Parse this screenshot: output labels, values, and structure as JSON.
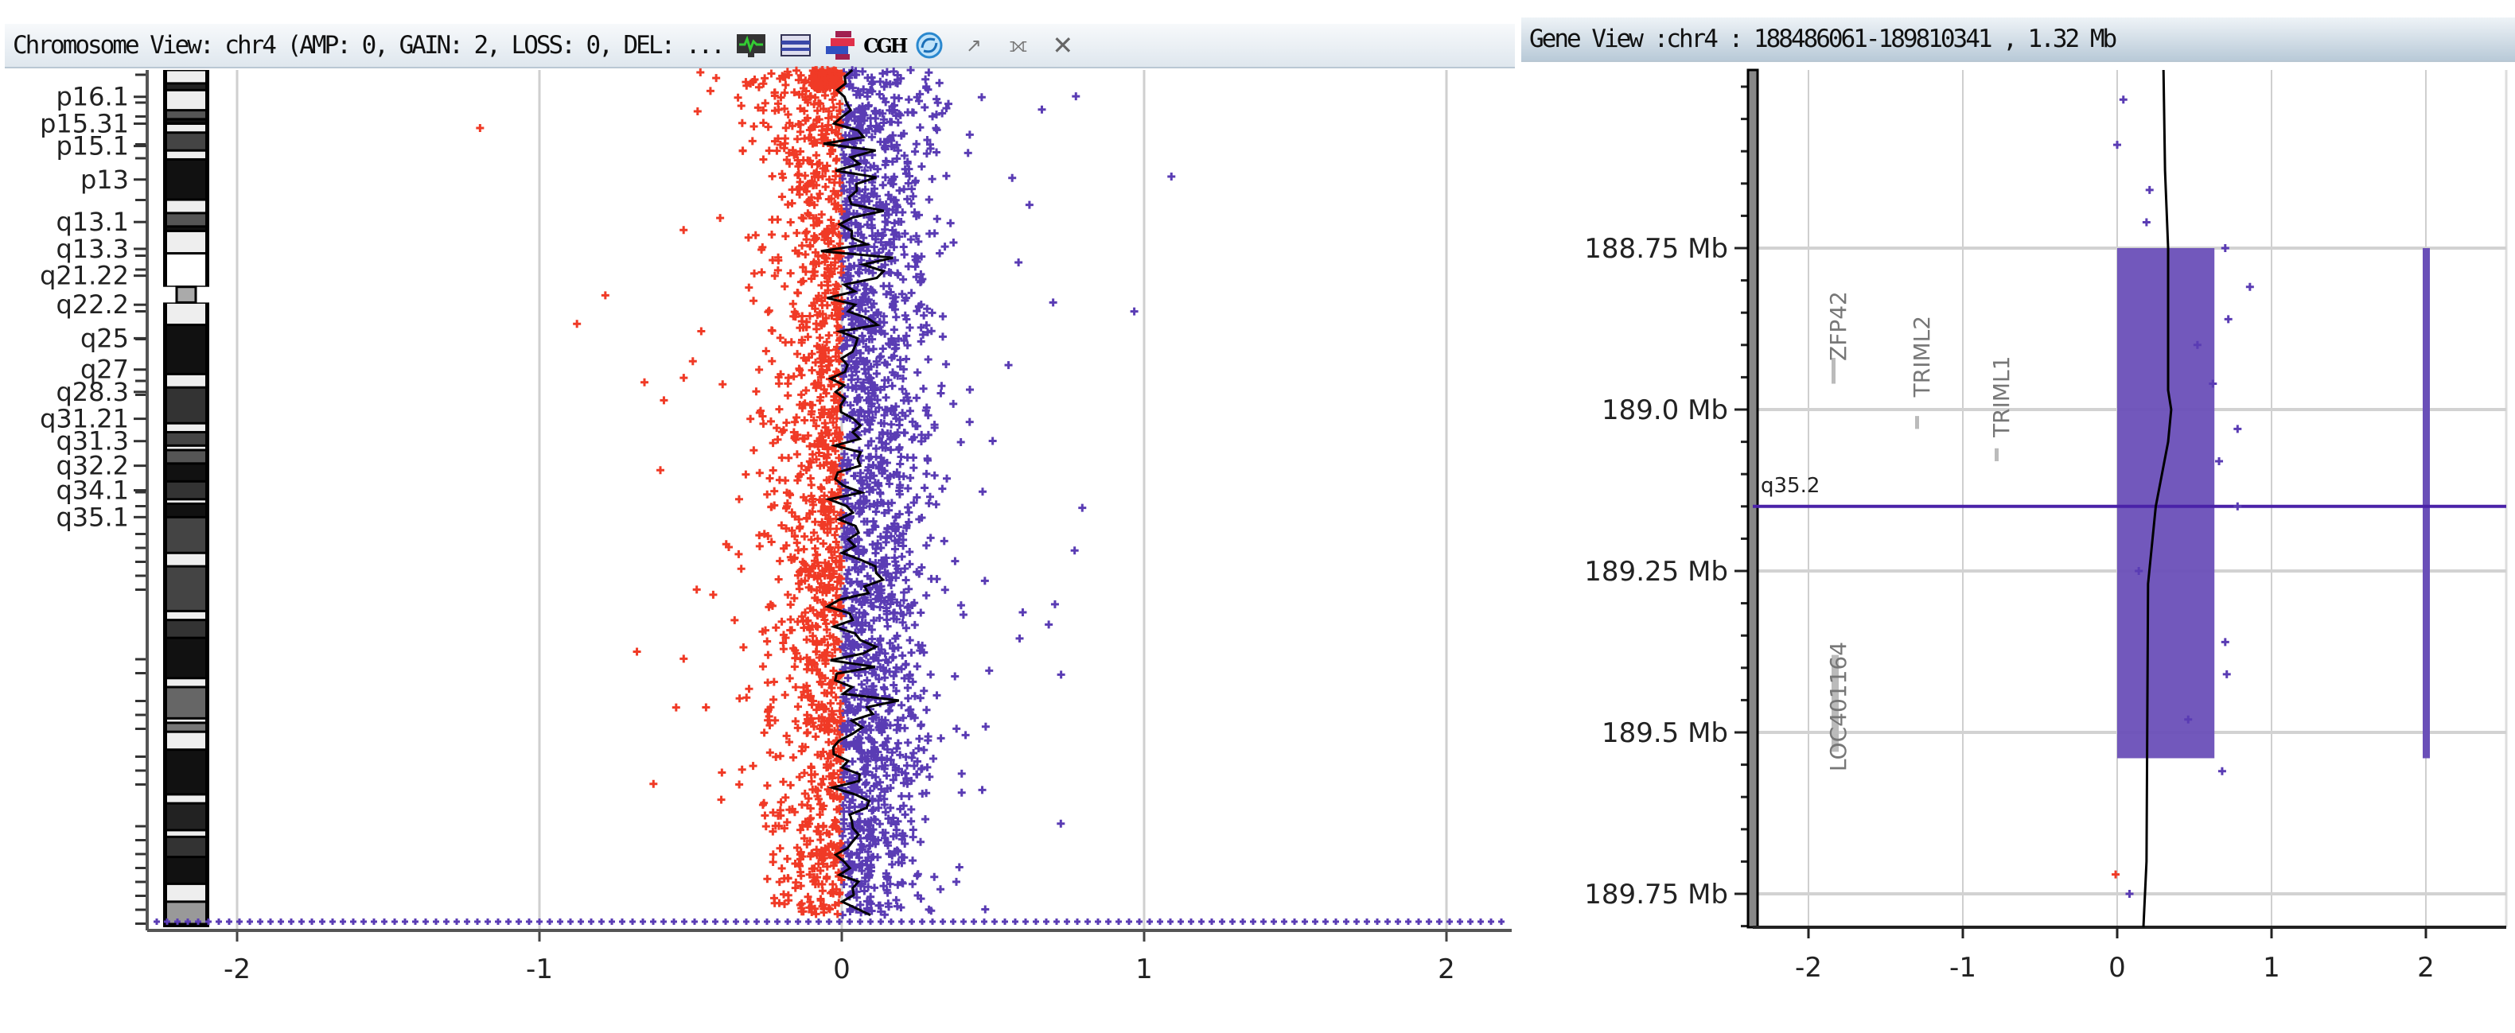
{
  "chromosome_view": {
    "title": "Chromosome View: chr4 (AMP: 0, GAIN: 2, LOSS: 0, DEL: ...",
    "icons": [
      "chart-monitor-icon",
      "lines-icon",
      "bars-icon",
      "cgh-icon",
      "refresh-icon",
      "restore-icon",
      "pin-icon",
      "close-icon"
    ],
    "cgh_label": "CGH"
  },
  "gene_view": {
    "title": "Gene View :chr4 : 188486061-189810341 , 1.32 Mb"
  },
  "colors": {
    "loss": "#f03a26",
    "gain": "#5a3cb4",
    "segment": "#6a4fb8",
    "line": "#000000"
  },
  "chart_data": [
    {
      "type": "scatter",
      "title": "Chromosome View: chr4",
      "xlabel": "",
      "ylabel": "",
      "xlim": [
        -2.3,
        2.2
      ],
      "xticks": [
        "-2",
        "-1",
        "0",
        "1",
        "2"
      ],
      "xtick_values": [
        -2,
        -1,
        0,
        1,
        2
      ],
      "y_unit": "Mb",
      "ylim": [
        0,
        191
      ],
      "band_labels": [
        "p16.1",
        "p15.31",
        "p15.1",
        "p13",
        "q13.1",
        "q13.3",
        "q21.22",
        "q22.2",
        "q25",
        "q27",
        "q28.3",
        "q31.21",
        "q31.3",
        "q32.2",
        "q34.1",
        "q35.1"
      ],
      "band_positions_mb": [
        6,
        12,
        17,
        24.5,
        34,
        40,
        46,
        52.5,
        60,
        67,
        72,
        78,
        83,
        88.5,
        94,
        100
      ],
      "grid": true,
      "points_summary": {
        "count_approx": 3000,
        "center": 0.03,
        "spread_sd": 0.13,
        "negative_color": "loss",
        "positive_color": "gain"
      },
      "mean_line_center": 0.03
    },
    {
      "type": "scatter",
      "title": "Gene View :chr4 : 188486061-189810341 , 1.32 Mb",
      "xlim": [
        -2.3,
        2.2
      ],
      "xticks": [
        "-2",
        "-1",
        "0",
        "1",
        "2"
      ],
      "xtick_values": [
        -2,
        -1,
        0,
        1,
        2
      ],
      "ylim": [
        188.45,
        189.81
      ],
      "yticks": [
        "188.75 Mb",
        "189.0 Mb",
        "189.25 Mb",
        "189.5 Mb",
        "189.75 Mb"
      ],
      "ytick_values": [
        188.75,
        189.0,
        189.25,
        189.5,
        189.75
      ],
      "band_marker": {
        "label": "q35.2",
        "position_mb": 189.15
      },
      "genes": [
        {
          "name": "ZFP42",
          "start_mb": 188.92,
          "end_mb": 188.96
        },
        {
          "name": "TRIML2",
          "start_mb": 189.01,
          "end_mb": 189.03
        },
        {
          "name": "TRIML1",
          "start_mb": 189.06,
          "end_mb": 189.08
        },
        {
          "name": "LOC401164",
          "start_mb": 189.38,
          "end_mb": 189.53
        }
      ],
      "segment": {
        "start_mb": 188.75,
        "end_mb": 189.54,
        "value": 0.63,
        "call": "GAIN"
      },
      "call_bar": {
        "start_mb": 188.75,
        "end_mb": 189.54,
        "value": 2
      },
      "points": [
        {
          "x": 0.04,
          "y": 188.52
        },
        {
          "x": 0.0,
          "y": 188.59
        },
        {
          "x": 0.21,
          "y": 188.66
        },
        {
          "x": 0.19,
          "y": 188.71
        },
        {
          "x": 0.7,
          "y": 188.75
        },
        {
          "x": 0.86,
          "y": 188.81
        },
        {
          "x": 0.72,
          "y": 188.86
        },
        {
          "x": 0.52,
          "y": 188.9
        },
        {
          "x": 0.62,
          "y": 188.96
        },
        {
          "x": 0.78,
          "y": 189.03
        },
        {
          "x": 0.66,
          "y": 189.08
        },
        {
          "x": 0.78,
          "y": 189.15
        },
        {
          "x": 0.14,
          "y": 189.25
        },
        {
          "x": 0.7,
          "y": 189.36
        },
        {
          "x": 0.71,
          "y": 189.41
        },
        {
          "x": 0.46,
          "y": 189.48
        },
        {
          "x": 0.68,
          "y": 189.56
        },
        {
          "x": -0.01,
          "y": 189.72
        },
        {
          "x": 0.08,
          "y": 189.75
        }
      ],
      "mean_line": [
        {
          "x": 0.3,
          "y": 188.45
        },
        {
          "x": 0.31,
          "y": 188.63
        },
        {
          "x": 0.33,
          "y": 188.75
        },
        {
          "x": 0.33,
          "y": 188.97
        },
        {
          "x": 0.35,
          "y": 189.0
        },
        {
          "x": 0.33,
          "y": 189.05
        },
        {
          "x": 0.25,
          "y": 189.15
        },
        {
          "x": 0.2,
          "y": 189.27
        },
        {
          "x": 0.19,
          "y": 189.7
        },
        {
          "x": 0.17,
          "y": 189.81
        }
      ]
    }
  ]
}
